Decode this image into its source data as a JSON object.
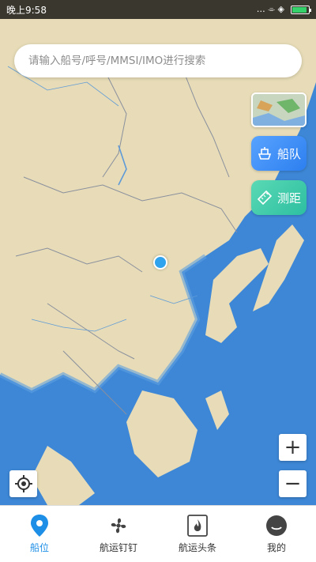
{
  "status_bar": {
    "time": "晚上9:58",
    "indicators": "… ⌯ ◈"
  },
  "search": {
    "placeholder": "请输入船号/呼号/MMSI/IMO进行搜索"
  },
  "side_buttons": {
    "fleet_label": "船队",
    "measure_label": "测距"
  },
  "zoom": {
    "in_label": "+",
    "out_label": "−"
  },
  "bottom_nav": [
    {
      "label": "船位",
      "icon": "location-pin-icon",
      "active": true
    },
    {
      "label": "航运钉钉",
      "icon": "fan-icon",
      "active": false
    },
    {
      "label": "航运头条",
      "icon": "flame-icon",
      "active": false
    },
    {
      "label": "我的",
      "icon": "profile-icon",
      "active": false
    }
  ],
  "colors": {
    "accent": "#1e8fe6",
    "land": "#e7dcb7",
    "sea": "#3d87d6",
    "fleet_button": "#3a8cf5",
    "measure_button": "#3ccaa8"
  }
}
